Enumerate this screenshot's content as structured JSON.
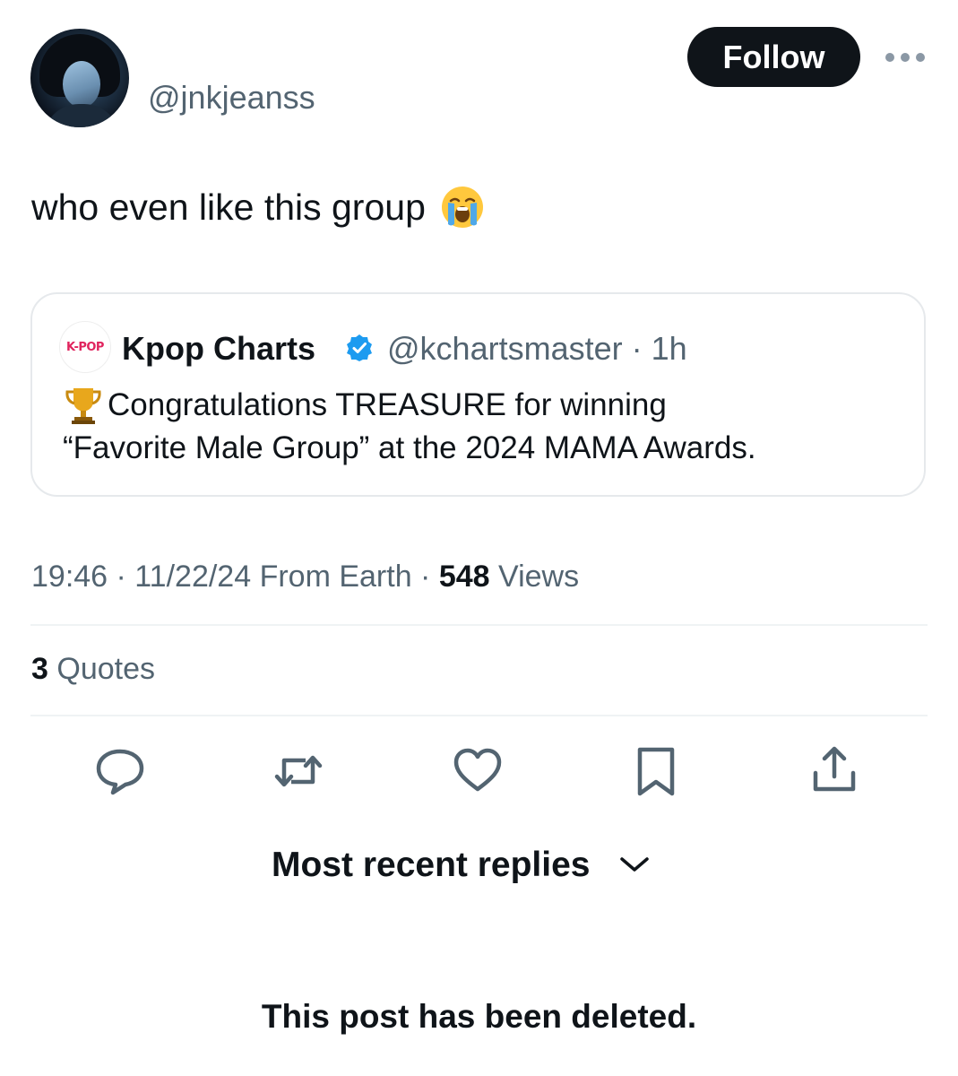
{
  "author": {
    "handle": "@jnkjeanss",
    "follow_label": "Follow"
  },
  "tweet": {
    "text": "who even like this group",
    "emoji": "loudly-crying-face"
  },
  "quoted_tweet": {
    "logo_text": "K-POP",
    "name": "Kpop Charts",
    "verified": true,
    "meta": "@kchartsmaster · 1h",
    "line1": "Congratulations TREASURE for winning",
    "line2": "“Favorite Male Group” at the 2024 MAMA Awards.",
    "line1_emoji": "trophy"
  },
  "meta": {
    "timestamp": "19:46 · 11/22/24 From Earth · ",
    "views_count": "548",
    "views_label": " Views"
  },
  "stats": {
    "quotes_count": "3",
    "quotes_label": " Quotes"
  },
  "actions": [
    {
      "name": "reply-icon"
    },
    {
      "name": "retweet-icon"
    },
    {
      "name": "like-icon"
    },
    {
      "name": "bookmark-icon"
    },
    {
      "name": "share-icon"
    }
  ],
  "replies": {
    "sort_label": "Most recent replies",
    "deleted_notice": "This post has been deleted."
  },
  "colors": {
    "text_primary": "#0f1419",
    "text_secondary": "#536471",
    "verified_blue": "#1d9bf0",
    "divider": "#eff3f4"
  }
}
